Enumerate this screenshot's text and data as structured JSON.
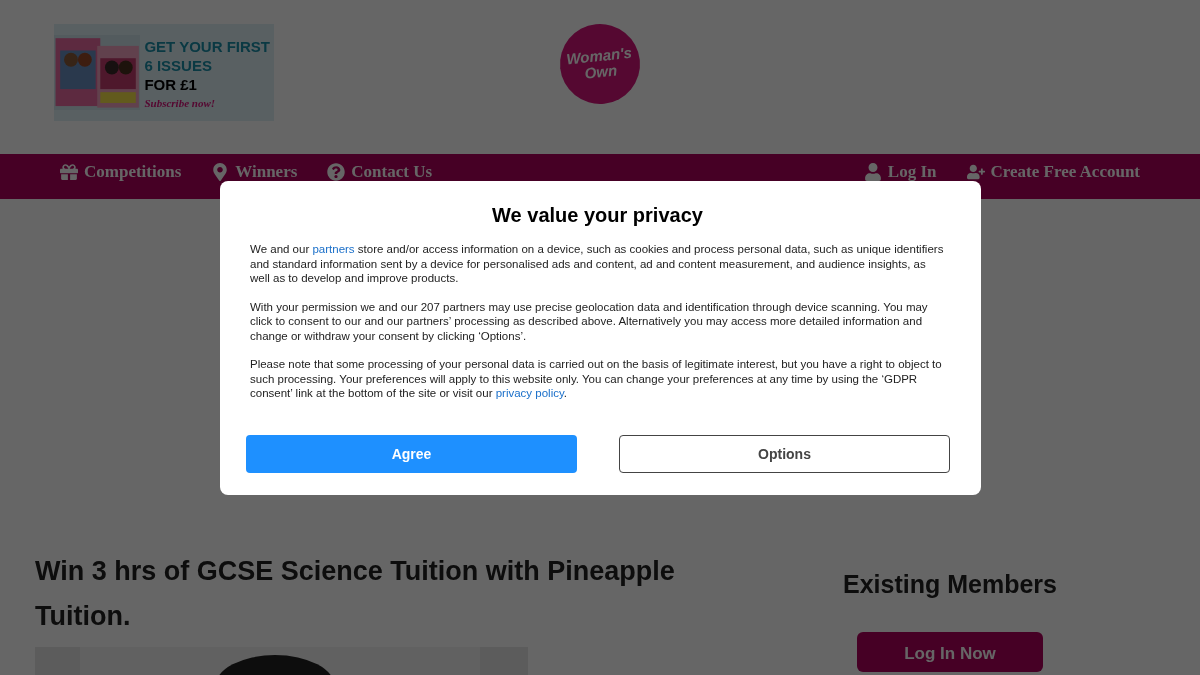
{
  "ad_banner": {
    "headline": [
      "GET YOUR FIRST",
      "6 ISSUES",
      "FOR £1"
    ],
    "call_to_action": "Subscribe now!"
  },
  "logo": {
    "lines": [
      "Woman's",
      "Own"
    ]
  },
  "nav": {
    "left": [
      {
        "label": "Competitions"
      },
      {
        "label": "Winners"
      },
      {
        "label": "Contact Us"
      }
    ],
    "right": [
      {
        "label": "Log In"
      },
      {
        "label": "Create Free Account"
      }
    ]
  },
  "article": {
    "title": "Win 3 hrs of GCSE Science Tuition with Pineapple Tuition."
  },
  "sidebar": {
    "heading": "Existing Members",
    "button": "Log In Now"
  },
  "consent_dialog": {
    "title": "We value your privacy",
    "paragraphs": [
      [
        {
          "kind": "text",
          "text": "We and our "
        },
        {
          "kind": "link",
          "text": "partners"
        },
        {
          "kind": "text",
          "text": " store and/or access information on a device, such as cookies and process personal data, such as unique identifiers and standard information sent by a device for personalised ads and content, ad and content measurement, and audience insights, as well as to develop and improve products."
        }
      ],
      [
        {
          "kind": "text",
          "text": "With your permission we and our 207 partners may use precise geolocation data and identification through device scanning. You may click to consent to our and our partners’ processing as described above. Alternatively you may access more detailed information and change or withdraw your consent by clicking ‘Options’."
        }
      ],
      [
        {
          "kind": "text",
          "text": "Please note that some processing of your personal data is carried out on the basis of legitimate interest, but you have a right to object to such processing. Your preferences will apply to this website only. You can change your preferences at any time by using the ‘GDPR consent’ link at the bottom of the site or visit our "
        },
        {
          "kind": "link",
          "text": "privacy policy"
        },
        {
          "kind": "text",
          "text": "."
        }
      ]
    ],
    "buttons": [
      {
        "label": "Agree",
        "kind": "primary"
      },
      {
        "label": "Options",
        "kind": "secondary"
      }
    ]
  }
}
